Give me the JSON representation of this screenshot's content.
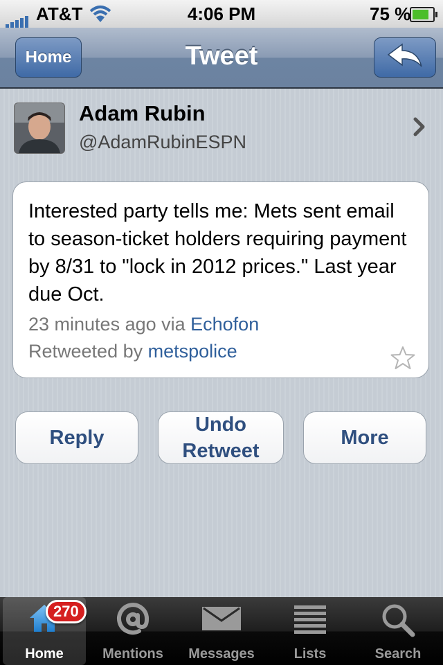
{
  "status_bar": {
    "carrier": "AT&T",
    "time": "4:06 PM",
    "battery": "75 %"
  },
  "nav": {
    "back_label": "Home",
    "title": "Tweet"
  },
  "profile": {
    "name": "Adam Rubin",
    "handle": "@AdamRubinESPN"
  },
  "tweet": {
    "text": "Interested party tells me: Mets sent email to season-ticket holders requiring payment by 8/31 to \"lock in 2012 prices.\" Last year due Oct.",
    "time_ago": "23 minutes ago via ",
    "source": "Echofon",
    "retweeted_prefix": "Retweeted by ",
    "retweeted_by": "metspolice"
  },
  "actions": {
    "reply": "Reply",
    "undo_line1": "Undo",
    "undo_line2": "Retweet",
    "more": "More"
  },
  "tabs": [
    {
      "label": "Home",
      "icon": "home-icon",
      "badge": "270",
      "active": true
    },
    {
      "label": "Mentions",
      "icon": "at-icon"
    },
    {
      "label": "Messages",
      "icon": "envelope-icon"
    },
    {
      "label": "Lists",
      "icon": "list-icon"
    },
    {
      "label": "Search",
      "icon": "search-icon"
    }
  ],
  "colors": {
    "nav_blue": "#6d84a2",
    "link": "#2f5f9b",
    "badge_red": "#d51f1f",
    "wifi_blue": "#3a6fb0"
  }
}
